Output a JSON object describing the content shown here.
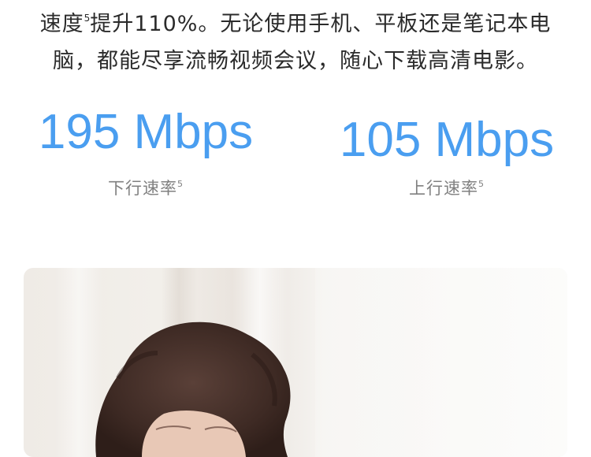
{
  "intro": {
    "line1_a": "速度",
    "line1_sup": "5",
    "line1_b": "提升110%。无论使用手机、平板还是笔记本电",
    "line2": "脑，都能尽享流畅视频会议，随心下载高清电影。"
  },
  "stats": {
    "downlink": {
      "value": "195 Mbps",
      "label": "下行速率",
      "sup": "5"
    },
    "uplink": {
      "value": "105 Mbps",
      "label": "上行速率",
      "sup": "5"
    }
  },
  "colors": {
    "accent": "#4a9ef0",
    "text": "#2b2b2b",
    "label": "#808080"
  }
}
